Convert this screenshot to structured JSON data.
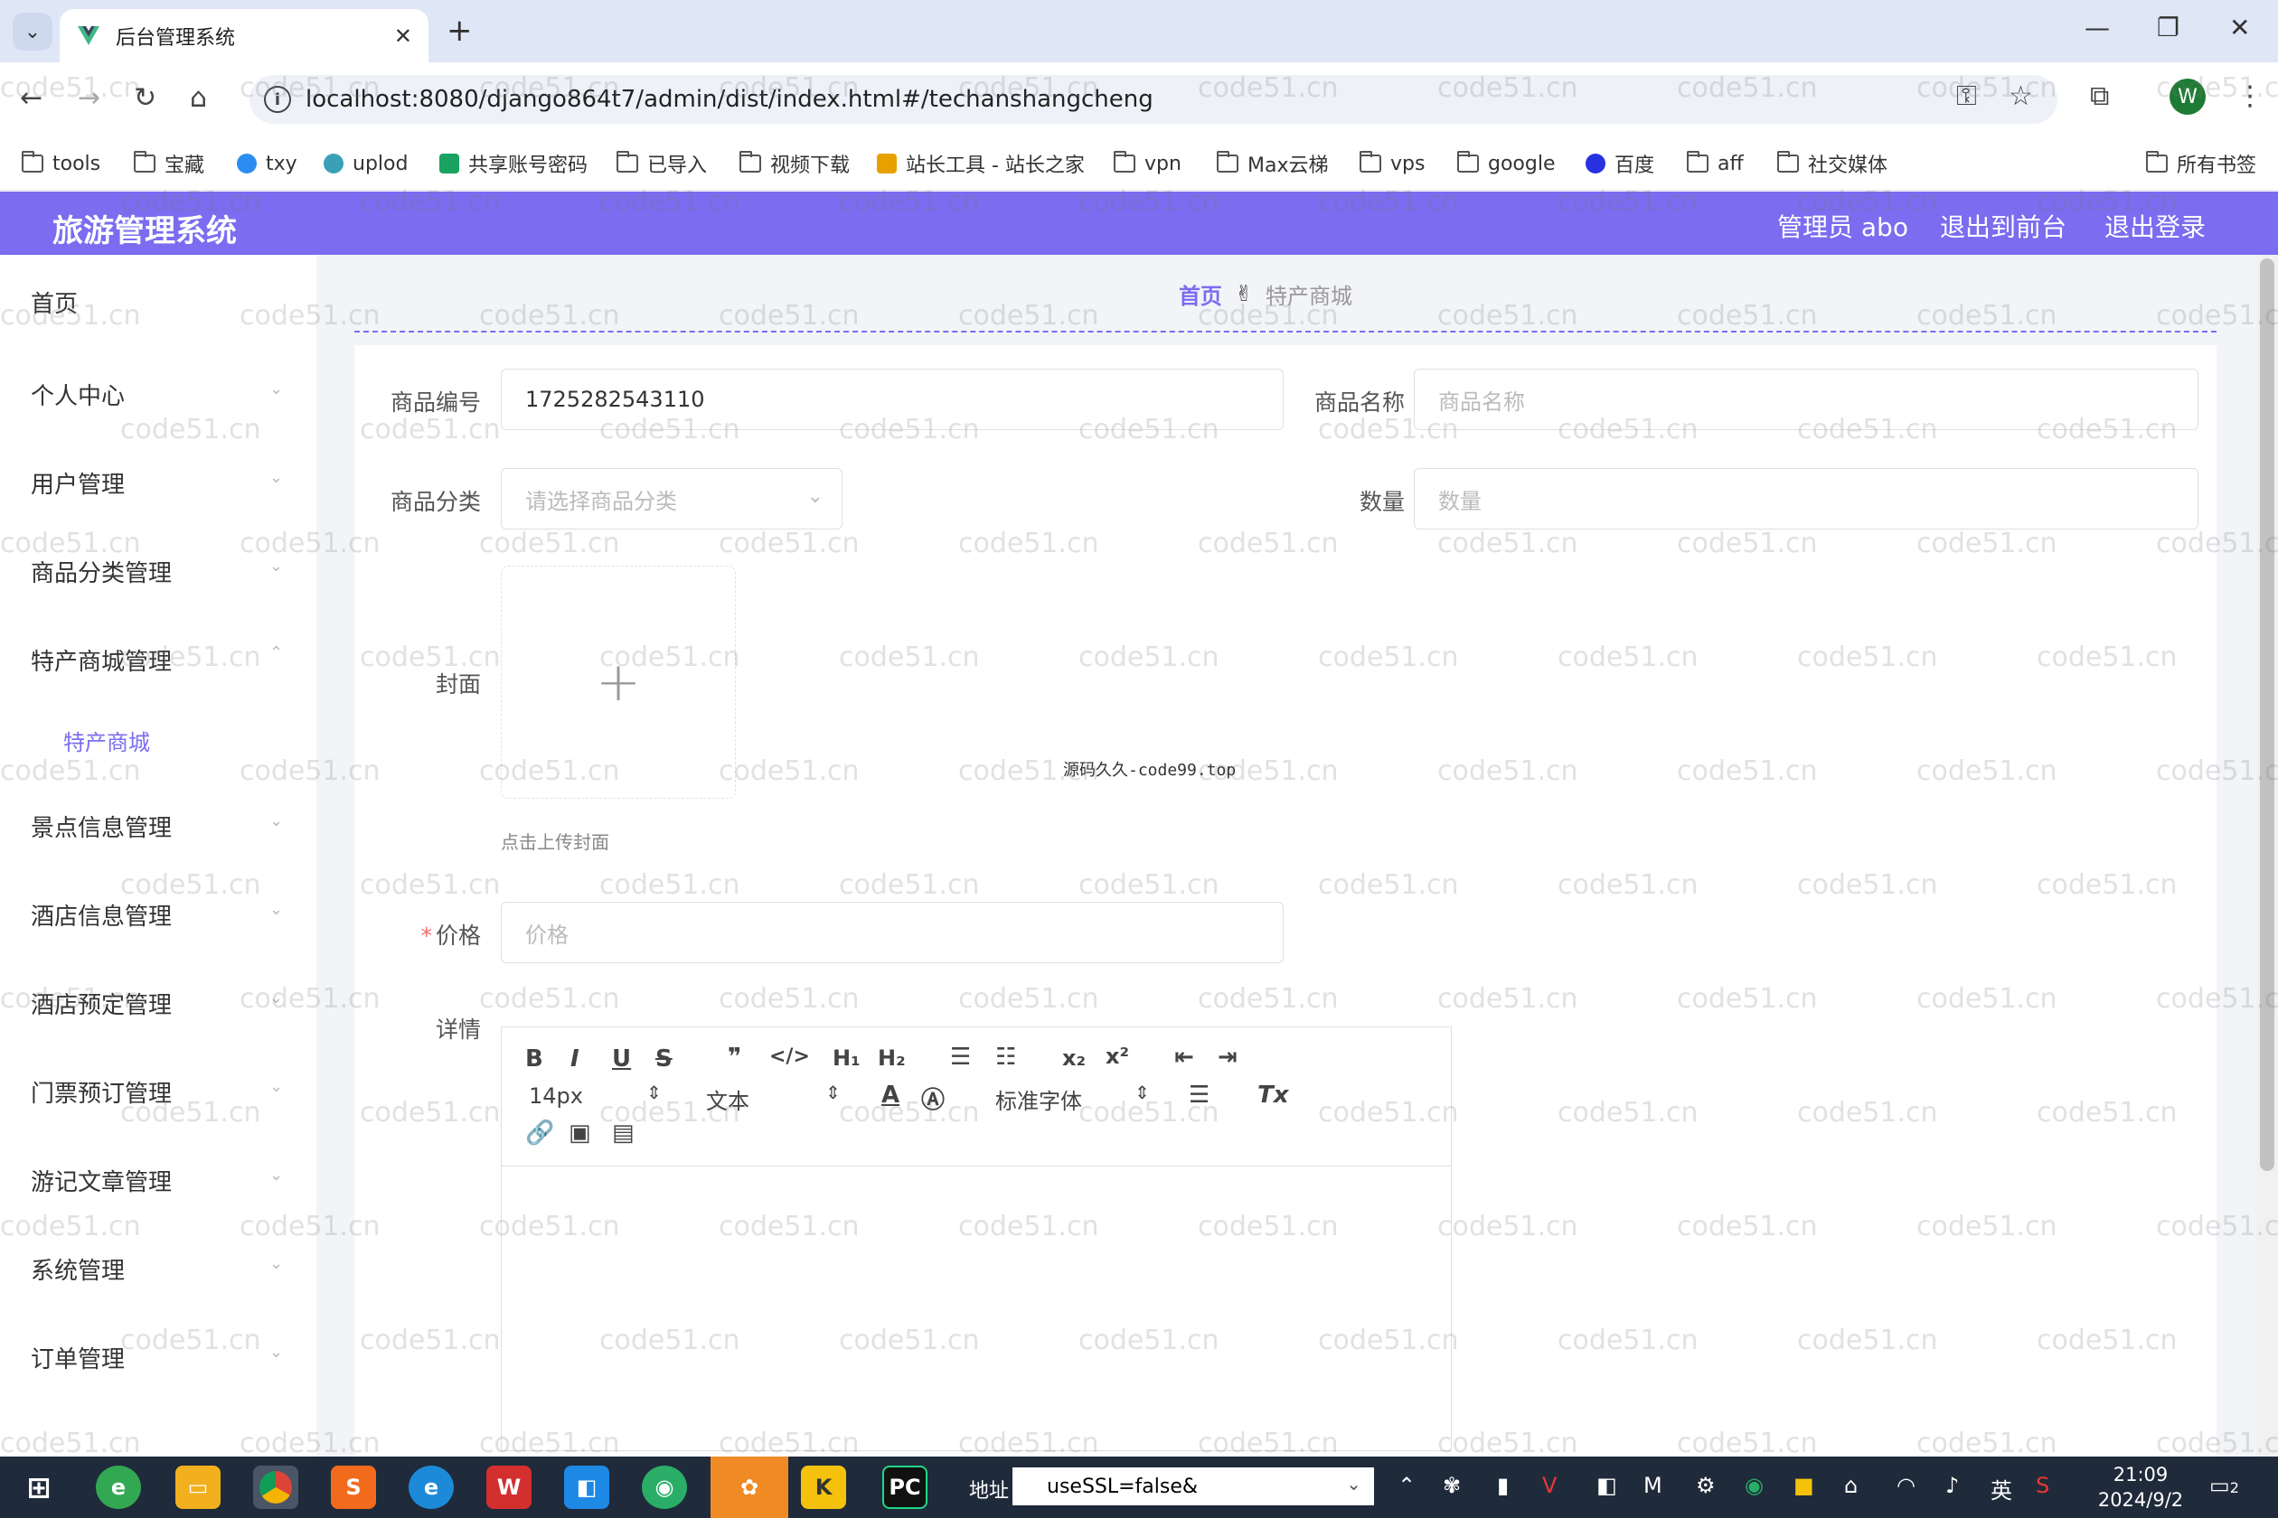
{
  "browser": {
    "tab_title": "后台管理系统",
    "url": "localhost:8080/django864t7/admin/dist/index.html#/techanshangcheng",
    "bookmarks": [
      "tools",
      "宝藏",
      "txy",
      "uplod",
      "共享账号密码",
      "已导入",
      "视频下载",
      "站长工具 - 站长之家",
      "vpn",
      "Max云梯",
      "vps",
      "google",
      "百度",
      "aff",
      "社交媒体"
    ],
    "all_bookmarks": "所有书签",
    "profile_initial": "W"
  },
  "header": {
    "title": "旅游管理系统",
    "admin": "管理员 abo",
    "back_front": "退出到前台",
    "logout": "退出登录"
  },
  "sidebar": {
    "items": [
      "首页",
      "个人中心",
      "用户管理",
      "商品分类管理",
      "特产商城管理",
      "景点信息管理",
      "酒店信息管理",
      "酒店预定管理",
      "门票预订管理",
      "游记文章管理",
      "系统管理",
      "订单管理"
    ],
    "sub_active": "特产商城"
  },
  "breadcrumb": {
    "home": "首页",
    "current": "特产商城"
  },
  "form": {
    "code_label": "商品编号",
    "code_value": "1725282543110",
    "name_label": "商品名称",
    "name_placeholder": "商品名称",
    "category_label": "商品分类",
    "category_placeholder": "请选择商品分类",
    "qty_label": "数量",
    "qty_placeholder": "数量",
    "cover_label": "封面",
    "cover_hint": "点击上传封面",
    "price_required": "*",
    "price_label": "价格",
    "price_placeholder": "价格",
    "detail_label": "详情",
    "watermark_note": "源码久久-code99.top"
  },
  "editor": {
    "font_size": "14px",
    "block_type": "文本",
    "font_family": "标准字体"
  },
  "watermark_text": "code51.cn",
  "taskbar": {
    "addr_label": "地址",
    "addr_value": "useSSL=false&",
    "ime": "英",
    "time": "21:09",
    "date": "2024/9/2",
    "notif_count": "2"
  },
  "colors": {
    "accent": "#7b6cf0",
    "header_bg": "#7b6cf0",
    "taskbar_bg": "#1f2a3a"
  }
}
